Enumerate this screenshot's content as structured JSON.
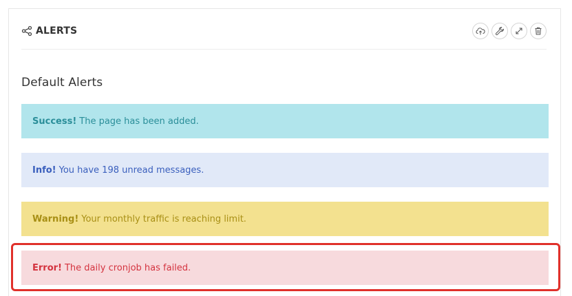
{
  "panel": {
    "title": "ALERTS",
    "title_icon": "share-icon",
    "tools": [
      {
        "name": "cloud-upload-icon"
      },
      {
        "name": "wrench-icon"
      },
      {
        "name": "expand-icon"
      },
      {
        "name": "trash-icon"
      }
    ]
  },
  "section": {
    "title": "Default Alerts"
  },
  "alerts": {
    "success": {
      "label": "Success!",
      "message": "The page has been added.",
      "bg": "#b1e5ec",
      "color": "#2a8e99"
    },
    "info": {
      "label": "Info!",
      "message": "You have 198 unread messages.",
      "bg": "#e1e9f8",
      "color": "#3a5fbd"
    },
    "warning": {
      "label": "Warning!",
      "message": "Your monthly traffic is reaching limit.",
      "bg": "#f3e18f",
      "color": "#a88f15"
    },
    "error": {
      "label": "Error!",
      "message": "The daily cronjob has failed.",
      "bg": "#f7dadd",
      "color": "#d4333f"
    }
  },
  "highlight_color": "#e0302a"
}
